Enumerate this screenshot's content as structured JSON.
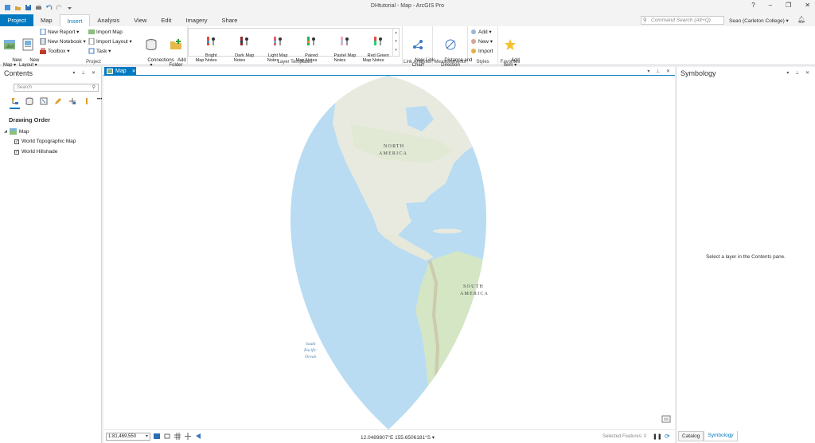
{
  "window": {
    "title": "DHtutorial - Map - ArcGIS Pro",
    "help": "?",
    "minimize": "–",
    "restore": "❐",
    "close": "✕"
  },
  "ribbon_tabs": [
    "Project",
    "Map",
    "Insert",
    "Analysis",
    "View",
    "Edit",
    "Imagery",
    "Share"
  ],
  "active_tab": "Insert",
  "command_search": {
    "placeholder": "Command Search (Alt+Q)"
  },
  "user": "Sean (Carleton College) ▾",
  "ribbon": {
    "project": {
      "label": "Project",
      "new_map": "New\nMap ▾",
      "new_layout": "New\nLayout ▾",
      "new_report": "New Report ▾",
      "new_notebook": "New Notebook ▾",
      "toolbox": "Toolbox ▾",
      "import_map": "Import Map",
      "import_layout": "Import Layout ▾",
      "task": "Task ▾",
      "connections": "Connections\n▾",
      "add_folder": "Add\nFolder"
    },
    "layer_templates": {
      "label": "Layer Templates",
      "items": [
        {
          "label": "Bright\nMap Notes"
        },
        {
          "label": "Dark Map\nNotes"
        },
        {
          "label": "Light Map\nNotes"
        },
        {
          "label": "Paired\nMap Notes"
        },
        {
          "label": "Pastel Map\nNotes"
        },
        {
          "label": "Red Green\nMap Notes"
        }
      ]
    },
    "link_analysis": {
      "label": "Link Analysis",
      "new_link_chart": "New Link\nChart"
    },
    "measurements": {
      "label": "Measurements",
      "distance_direction": "Distance and\nDirection"
    },
    "styles": {
      "label": "Styles",
      "add": "Add ▾",
      "new": "New ▾",
      "import": "Import"
    },
    "favorites": {
      "label": "Favorites",
      "add_item": "Add\nItem ▾"
    }
  },
  "contents": {
    "title": "Contents",
    "pane_controls": "▾ ⊥ ✕",
    "search_placeholder": "Search",
    "drawing_order": "Drawing Order",
    "map_name": "Map",
    "layers": [
      {
        "name": "World Topographic Map",
        "checked": true
      },
      {
        "name": "World Hillshade",
        "checked": true
      }
    ],
    "check_mark": "✓",
    "more": "•••"
  },
  "map_view": {
    "tab_label": "Map",
    "tab_close": "✕",
    "view_controls": "▾ ⊥ ✕",
    "labels": {
      "north_america": [
        "NORTH",
        "AMERICA"
      ],
      "south_america": [
        "SOUTH",
        "AMERICA"
      ],
      "south_pacific": [
        "South",
        "Pacific",
        "Ocean"
      ]
    },
    "scale": "1:81,469,550",
    "coordinates": "12.0489807°E 155.6506181°S  ▾",
    "selected_features": "Selected Features: 0",
    "pause": "❚❚",
    "refresh": "⟳"
  },
  "symbology": {
    "title": "Symbology",
    "pane_controls": "▾ ⊥ ✕",
    "message": "Select a layer in the Contents pane.",
    "tabs": [
      "Catalog",
      "Symbology"
    ],
    "active_tab": "Symbology"
  },
  "colors": {
    "accent": "#0079c1",
    "ocean": "#b9dcf3",
    "land": "#e9eadf",
    "vegetation": "#d4e6c4"
  }
}
